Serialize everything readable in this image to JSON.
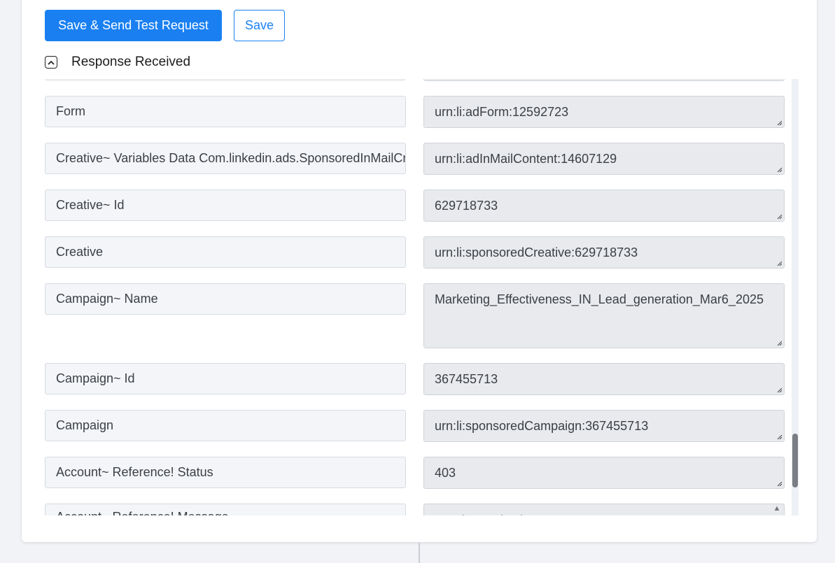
{
  "toolbar": {
    "save_send_label": "Save & Send Test Request",
    "save_label": "Save"
  },
  "response": {
    "title": "Response Received",
    "rows": [
      {
        "key": "",
        "value": ""
      },
      {
        "key": "Form",
        "value": "urn:li:adForm:12592723"
      },
      {
        "key": "Creative~ Variables Data Com.linkedin.ads.SponsoredInMailCreativeVariables Content",
        "value": "urn:li:adInMailContent:14607129"
      },
      {
        "key": "Creative~ Id",
        "value": "629718733"
      },
      {
        "key": "Creative",
        "value": "urn:li:sponsoredCreative:629718733"
      },
      {
        "key": "Campaign~ Name",
        "value": "Marketing_Effectiveness_IN_Lead_generation_Mar6_2025"
      },
      {
        "key": "Campaign~ Id",
        "value": "367455713"
      },
      {
        "key": "Campaign",
        "value": "urn:li:sponsoredCampaign:367455713"
      },
      {
        "key": "Account~ Reference! Status",
        "value": "403"
      },
      {
        "key": "Account~ Reference! Message",
        "value": "... using projection BATCH_GET_AD_VERSION"
      }
    ]
  }
}
